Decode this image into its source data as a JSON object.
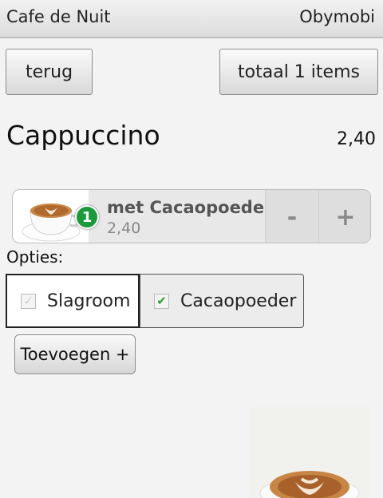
{
  "header": {
    "title": "Cafe de Nuit",
    "brand": "Obymobi"
  },
  "nav": {
    "back_label": "terug",
    "total_label": "totaal 1 items"
  },
  "product": {
    "name": "Cappuccino",
    "price": "2,40"
  },
  "order_item": {
    "quantity": "1",
    "name": "met Cacaopoeder",
    "price": "2,40",
    "minus_label": "-",
    "plus_label": "+"
  },
  "options": {
    "label": "Opties:",
    "items": [
      {
        "label": "Slagroom",
        "checked": false
      },
      {
        "label": "Cacaopoeder",
        "checked": true
      }
    ]
  },
  "actions": {
    "add_label": "Toevoegen +"
  },
  "colors": {
    "badge": "#1a9a3a",
    "check": "#2e9b2e"
  },
  "icons": {
    "thumbnail": "cappuccino-cup-icon",
    "photo": "cappuccino-photo",
    "check": "checkmark-icon"
  }
}
